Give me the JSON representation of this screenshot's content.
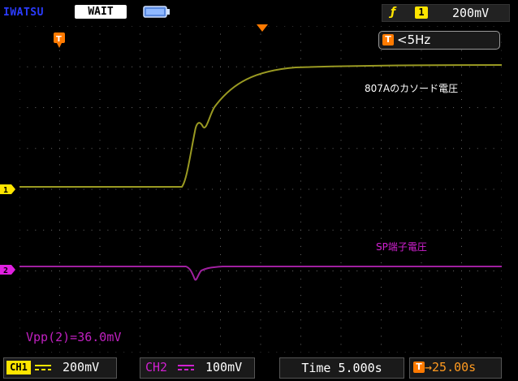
{
  "brand": "IWATSU",
  "status": "WAIT",
  "trigger": {
    "edge_icon": "rising-edge-icon",
    "channel": "1",
    "level": "200mV"
  },
  "trigger_freq": {
    "icon_label": "T",
    "value": "<5Hz"
  },
  "trigger_marker_label": "T",
  "ch1_marker_label": "1",
  "ch2_marker_label": "2",
  "annotations": {
    "ch1": "807Aのカソード電圧",
    "ch2": "SP端子電圧"
  },
  "measurement": "Vpp(2)=36.0mV",
  "channels": [
    {
      "tag": "CH1",
      "coupling": "DC",
      "scale": "200mV",
      "color": "#ffe500"
    },
    {
      "tag": "CH2",
      "coupling": "DC",
      "scale": "100mV",
      "color": "#d020d0"
    }
  ],
  "timebase": "Time 5.000s",
  "trigger_position": {
    "icon_label": "T",
    "value": "→25.00s"
  },
  "colors": {
    "ch1_trace": "#9a9a22",
    "ch2_trace": "#a020a0",
    "trigger_marker": "#ff7a00",
    "grid": "#6a6a6a"
  }
}
